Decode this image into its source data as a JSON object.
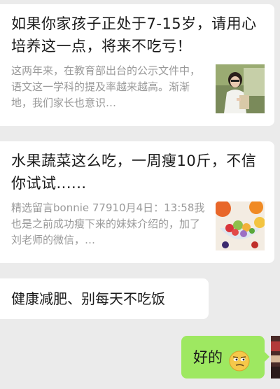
{
  "messages": [
    {
      "title": "如果你家孩子正处于7-15岁，请用心培养这一点，将来不吃亏！",
      "summary": "这两年来，在教育部出台的公示文件中，语文这一学科的提及率越来越高。渐渐地，我们家长也意识…",
      "thumb_icon": "girl-reading-photo"
    },
    {
      "title": "水果蔬菜这么吃，一周瘦10斤，不信你试试......",
      "summary": "精选留言bonnie 77910月4日：13:58我也是之前成功瘦下来的妹妹介绍的，加了刘老师的微信，…",
      "thumb_icon": "fruit-salad-photo"
    }
  ],
  "text_message": "健康减肥、别每天不吃饭",
  "my_reply": {
    "text": "好的",
    "emoji": "smirk-emoji"
  },
  "colors": {
    "background": "#ebebeb",
    "bubble_white": "#ffffff",
    "bubble_green": "#9ee861",
    "summary_gray": "#9a9a9a"
  }
}
